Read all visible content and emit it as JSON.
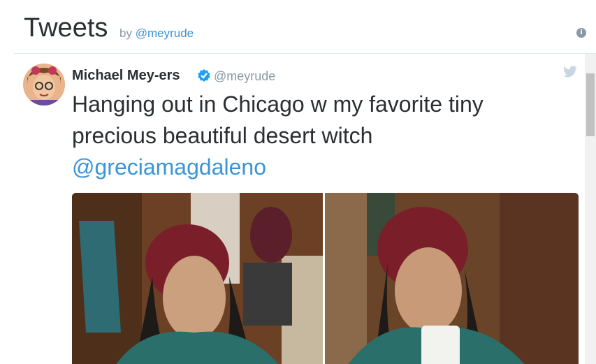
{
  "header": {
    "title": "Tweets",
    "by_prefix": "by",
    "by_handle": "@meyrude",
    "info_icon": "info-icon"
  },
  "tweet": {
    "author_name": "Michael Mey-ers",
    "author_handle": "@meyrude",
    "verified_icon": "verified-badge-icon",
    "bird_icon": "twitter-bird-icon",
    "text_line": "Hanging out in Chicago w my favorite tiny precious beautiful desert witch",
    "mention": "@greciamagdaleno"
  },
  "colors": {
    "link": "#3b94d9",
    "text": "#292f33",
    "muted": "#8899a6",
    "verified": "#1da1f2"
  }
}
